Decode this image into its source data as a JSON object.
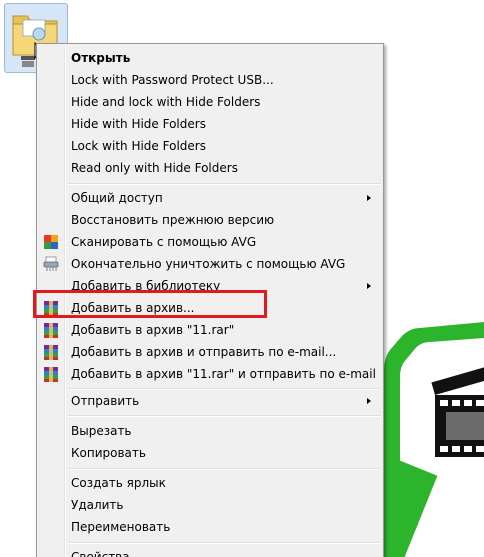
{
  "context_menu": {
    "open_label": "Открыть",
    "items_group_1": [
      {
        "label": "Lock with Password Protect USB..."
      },
      {
        "label": "Hide and lock with Hide Folders"
      },
      {
        "label": "Hide with Hide Folders"
      },
      {
        "label": "Lock with Hide Folders"
      },
      {
        "label": "Read only with Hide Folders"
      }
    ],
    "items_group_2": [
      {
        "label": "Общий доступ",
        "submenu": true
      },
      {
        "label": "Восстановить прежнюю версию"
      },
      {
        "label": "Сканировать с помощью AVG",
        "icon": "avg-scan-icon"
      },
      {
        "label": "Окончательно уничтожить с помощью AVG",
        "icon": "avg-shredder-icon"
      },
      {
        "label": "Добавить в библиотеку",
        "submenu": true
      },
      {
        "label": "Добавить в архив...",
        "icon": "winrar-icon",
        "highlighted": true
      },
      {
        "label": "Добавить в архив \"11.rar\"",
        "icon": "winrar-icon"
      },
      {
        "label": "Добавить в архив и отправить по e-mail...",
        "icon": "winrar-icon"
      },
      {
        "label": "Добавить в архив \"11.rar\" и отправить по e-mail",
        "icon": "winrar-icon"
      }
    ],
    "send_to_label": "Отправить",
    "items_group_4": [
      {
        "label": "Вырезать"
      },
      {
        "label": "Копировать"
      }
    ],
    "items_group_5": [
      {
        "label": "Создать ярлык"
      },
      {
        "label": "Удалить"
      },
      {
        "label": "Переименовать"
      }
    ],
    "properties_label": "Свойства",
    "highlight_color": "#e31a1c"
  },
  "desktop": {
    "selected_icon": "folder-icon",
    "background_graphic": "film-clapper-logo",
    "accent_green": "#2cb52c"
  }
}
